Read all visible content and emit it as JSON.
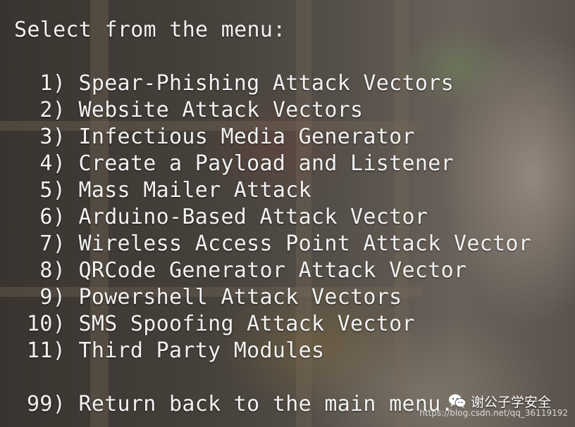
{
  "terminal": {
    "prompt": "Select from the menu:",
    "menu": [
      {
        "number": " 1)",
        "label": "Spear-Phishing Attack Vectors"
      },
      {
        "number": " 2)",
        "label": "Website Attack Vectors"
      },
      {
        "number": " 3)",
        "label": "Infectious Media Generator"
      },
      {
        "number": " 4)",
        "label": "Create a Payload and Listener"
      },
      {
        "number": " 5)",
        "label": "Mass Mailer Attack"
      },
      {
        "number": " 6)",
        "label": "Arduino-Based Attack Vector"
      },
      {
        "number": " 7)",
        "label": "Wireless Access Point Attack Vector"
      },
      {
        "number": " 8)",
        "label": "QRCode Generator Attack Vector"
      },
      {
        "number": " 9)",
        "label": "Powershell Attack Vectors"
      },
      {
        "number": "10)",
        "label": "SMS Spoofing Attack Vector"
      },
      {
        "number": "11)",
        "label": "Third Party Modules"
      }
    ],
    "return_item": {
      "number": "99)",
      "label": "Return back to the main menu."
    }
  },
  "watermark": {
    "account": "谢公子学安全",
    "url": "https://blog.csdn.net/qq_36119192",
    "icon": "wechat-icon"
  }
}
